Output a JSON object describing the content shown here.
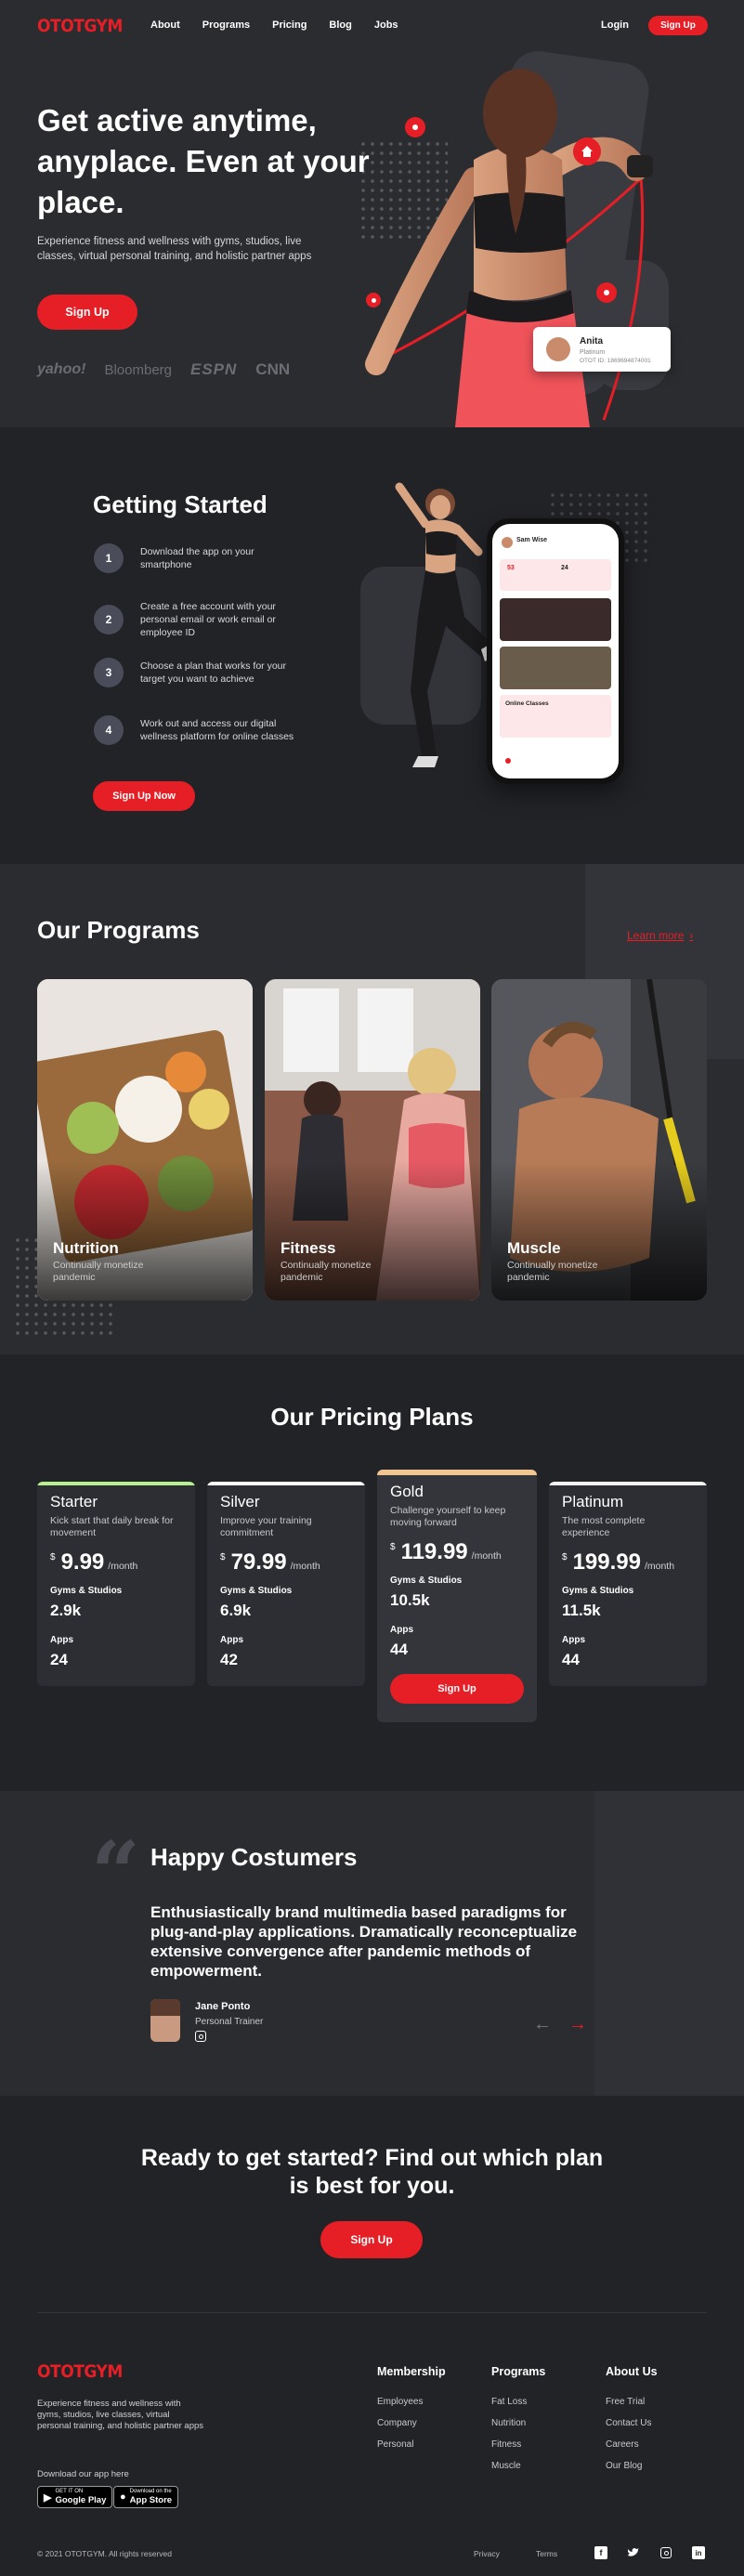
{
  "brand": {
    "name": "OTOTGYM",
    "accent": "#e61e25"
  },
  "nav": {
    "links": [
      "About",
      "Programs",
      "Pricing",
      "Blog",
      "Jobs"
    ],
    "login": "Login",
    "signup": "Sign Up"
  },
  "hero": {
    "headline": "Get active anytime, anyplace. Even at your place.",
    "subtext": "Experience fitness and wellness with gyms, studios, live classes, virtual personal training, and holistic partner apps",
    "cta": "Sign Up",
    "partners": [
      "yahoo!",
      "Bloomberg",
      "ESPN",
      "CNN"
    ],
    "member_card": {
      "name": "Anita",
      "tier": "Platinum",
      "id": "OTOT ID: 1869694874001"
    }
  },
  "getting_started": {
    "title": "Getting Started",
    "steps": [
      {
        "n": "1",
        "text": "Download the app on your smartphone"
      },
      {
        "n": "2",
        "text": "Create a free account with your personal email or work email or employee ID"
      },
      {
        "n": "3",
        "text": "Choose a plan that works for your target you want to achieve"
      },
      {
        "n": "4",
        "text": "Work out and access our digital wellness platform for online classes"
      }
    ],
    "cta": "Sign Up Now",
    "phone": {
      "user": "Sam Wise",
      "stat1": "53",
      "stat2": "24",
      "section": "Online Classes"
    }
  },
  "programs": {
    "title": "Our Programs",
    "learn_more": "Learn more",
    "items": [
      {
        "title": "Nutrition",
        "subtitle": "Continually monetize pandemic"
      },
      {
        "title": "Fitness",
        "subtitle": "Continually monetize pandemic"
      },
      {
        "title": "Muscle",
        "subtitle": "Continually monetize pandemic"
      }
    ]
  },
  "pricing": {
    "title": "Our Pricing Plans",
    "currency": "$",
    "per": "/month",
    "gyms_label": "Gyms & Studios",
    "apps_label": "Apps",
    "cta": "Sign Up",
    "plans": [
      {
        "name": "Starter",
        "desc": "Kick start that daily break for movement",
        "price": "9.99",
        "gyms": "2.9k",
        "apps": "24",
        "color": "#b7f08f"
      },
      {
        "name": "Silver",
        "desc": "Improve your training commitment",
        "price": "79.99",
        "gyms": "6.9k",
        "apps": "42",
        "color": "#ffffff"
      },
      {
        "name": "Gold",
        "desc": "Challenge yourself to keep moving forward",
        "price": "119.99",
        "gyms": "10.5k",
        "apps": "44",
        "color": "#f0c592"
      },
      {
        "name": "Platinum",
        "desc": "The most complete experience",
        "price": "199.99",
        "gyms": "11.5k",
        "apps": "44",
        "color": "#f2f2f2"
      }
    ]
  },
  "testimonial": {
    "title": "Happy Costumers",
    "quote": "Enthusiastically brand multimedia based paradigms for plug-and-play applications. Dramatically reconceptualize extensive convergence after pandemic methods of empowerment.",
    "author": "Jane Ponto",
    "role": "Personal Trainer"
  },
  "cta": {
    "headline": "Ready to get started? Find out which plan is best for you.",
    "button": "Sign Up"
  },
  "footer": {
    "about": "Experience fitness and wellness with gyms, studios, live classes, virtual personal training, and holistic partner apps",
    "download": "Download our app here",
    "google": {
      "small": "GET IT ON",
      "big": "Google Play"
    },
    "apple": {
      "small": "Download on the",
      "big": "App Store"
    },
    "columns": [
      {
        "title": "Membership",
        "links": [
          "Employees",
          "Company",
          "Personal"
        ]
      },
      {
        "title": "Programs",
        "links": [
          "Fat Loss",
          "Nutrition",
          "Fitness",
          "Muscle"
        ]
      },
      {
        "title": "About Us",
        "links": [
          "Free Trial",
          "Contact Us",
          "Careers",
          "Our Blog"
        ]
      }
    ],
    "copyright": "© 2021 OTOTGYM. All rights reserved",
    "privacy": "Privacy",
    "terms": "Terms",
    "social_icons": [
      "facebook-icon",
      "twitter-icon",
      "instagram-icon",
      "linkedin-icon"
    ]
  }
}
